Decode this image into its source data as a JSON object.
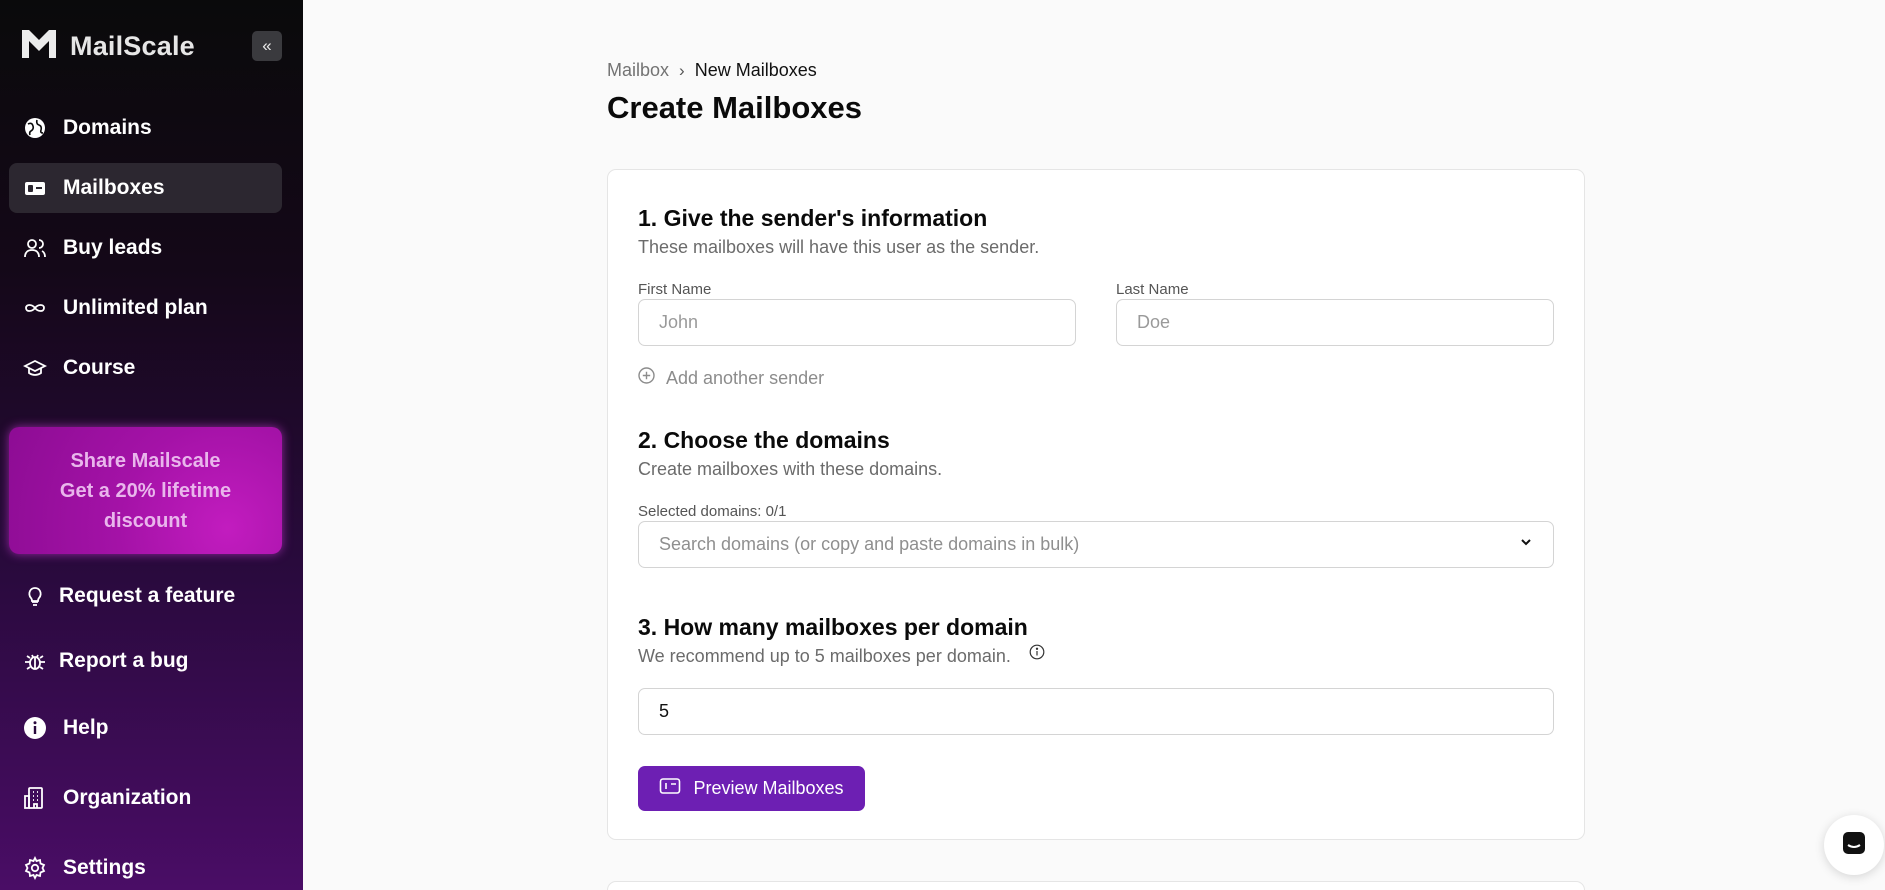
{
  "app": {
    "name": "MailScale",
    "brand_color": "#6d1fb3"
  },
  "sidebar": {
    "collapse_icon": "chevrons-left-icon",
    "items": [
      {
        "label": "Domains",
        "icon": "globe-icon",
        "active": false
      },
      {
        "label": "Mailboxes",
        "icon": "mailbox-icon",
        "active": true
      },
      {
        "label": "Buy leads",
        "icon": "users-icon",
        "active": false
      },
      {
        "label": "Unlimited plan",
        "icon": "infinity-icon",
        "active": false
      },
      {
        "label": "Course",
        "icon": "graduation-cap-icon",
        "active": false
      }
    ],
    "promo": {
      "line1": "Share Mailscale",
      "line2": "Get a 20% lifetime",
      "line3": "discount"
    },
    "bottom_items": [
      {
        "label": "Request a feature",
        "icon": "lightbulb-icon"
      },
      {
        "label": "Report a bug",
        "icon": "bug-icon"
      },
      {
        "label": "Help",
        "icon": "info-icon"
      },
      {
        "label": "Organization",
        "icon": "building-icon"
      },
      {
        "label": "Settings",
        "icon": "gear-icon"
      }
    ]
  },
  "breadcrumb": {
    "parent": "Mailbox",
    "separator": "›",
    "current": "New Mailboxes"
  },
  "page": {
    "title": "Create Mailboxes"
  },
  "form": {
    "section1": {
      "title": "1. Give the sender's information",
      "subtitle": "These mailboxes will have this user as the sender.",
      "first_name_label": "First Name",
      "first_name_placeholder": "John",
      "first_name_value": "",
      "last_name_label": "Last Name",
      "last_name_placeholder": "Doe",
      "last_name_value": "",
      "add_sender_label": "Add another sender"
    },
    "section2": {
      "title": "2. Choose the domains",
      "subtitle": "Create mailboxes with these domains.",
      "selected_label": "Selected domains: 0/1",
      "search_placeholder": "Search domains (or copy and paste domains in bulk)"
    },
    "section3": {
      "title": "3. How many mailboxes per domain",
      "subtitle": "We recommend up to 5 mailboxes per domain.",
      "count_value": "5"
    },
    "preview_button_label": "Preview Mailboxes"
  }
}
